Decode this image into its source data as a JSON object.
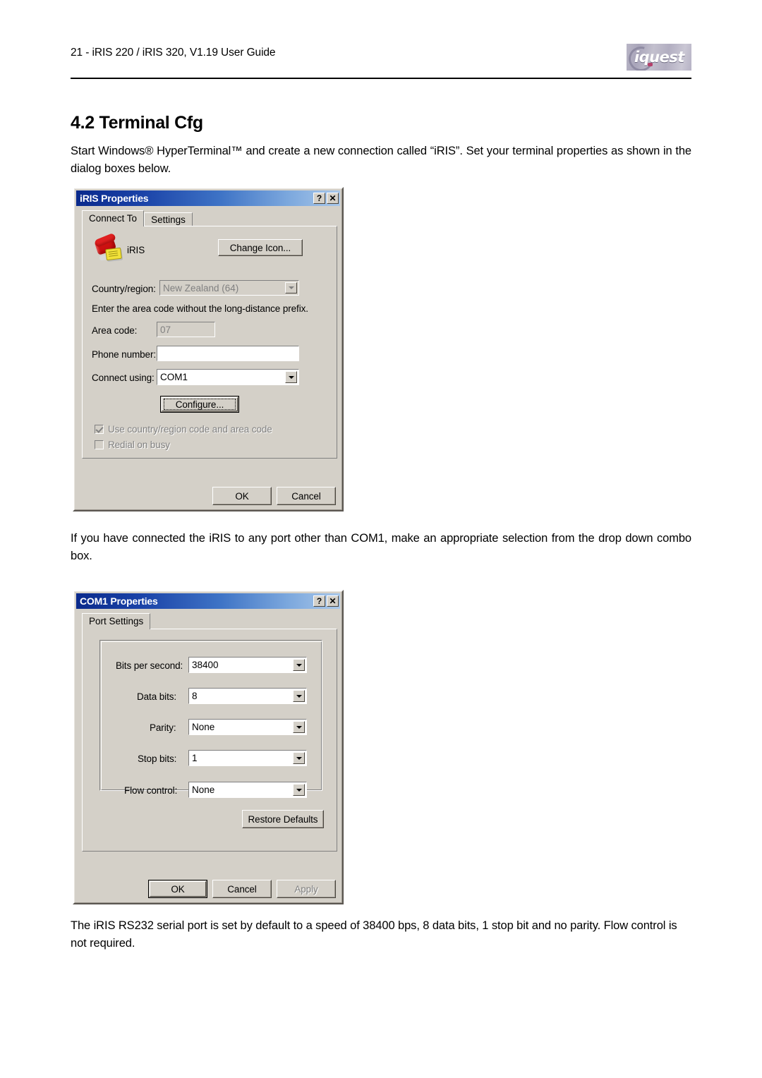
{
  "header": {
    "running_head": "21 - iRIS 220 / iRIS 320, V1.19 User Guide",
    "logo_text": "iquest"
  },
  "section": {
    "title": "4.2 Terminal Cfg",
    "intro_paragraph": "Start Windows® HyperTerminal™ and create a new connection called “iRIS”.  Set your terminal properties as shown in the dialog boxes below.",
    "middle_paragraph": "If you have connected the iRIS to any port other than COM1, make an appropriate selection from the drop down combo box.",
    "closing_paragraph": "The iRIS RS232 serial port is set by default to a speed of 38400 bps, 8 data bits, 1 stop bit and no parity. Flow control is not required."
  },
  "iris_dialog": {
    "title": "iRIS Properties",
    "help_button": "?",
    "close_button": "✕",
    "tabs": [
      {
        "label": "Connect To",
        "active": true
      },
      {
        "label": "Settings",
        "active": false
      }
    ],
    "connection_name": "iRIS",
    "change_icon_button": "Change Icon...",
    "country_label": "Country/region:",
    "country_value": "New Zealand (64)",
    "hint_text": "Enter the area code without the long-distance prefix.",
    "area_code_label": "Area code:",
    "area_code_value": "07",
    "phone_number_label": "Phone number:",
    "phone_number_value": "",
    "connect_using_label": "Connect using:",
    "connect_using_value": "COM1",
    "configure_button": "Configure...",
    "checkbox_country_code": "Use country/region code and area code",
    "checkbox_redial": "Redial on busy",
    "ok_button": "OK",
    "cancel_button": "Cancel"
  },
  "com1_dialog": {
    "title": "COM1 Properties",
    "help_button": "?",
    "close_button": "✕",
    "tabs": [
      {
        "label": "Port Settings",
        "active": true
      }
    ],
    "settings": [
      {
        "label": "Bits per second:",
        "value": "38400"
      },
      {
        "label": "Data bits:",
        "value": "8"
      },
      {
        "label": "Parity:",
        "value": "None"
      },
      {
        "label": "Stop bits:",
        "value": "1"
      },
      {
        "label": "Flow control:",
        "value": "None"
      }
    ],
    "restore_defaults_button": "Restore Defaults",
    "ok_button": "OK",
    "cancel_button": "Cancel",
    "apply_button": "Apply"
  },
  "colors": {
    "dialog_face": "#d4d0c8",
    "titlebar_start": "#0a2a8c",
    "titlebar_end": "#a9c8ea",
    "disabled_text": "#808080"
  }
}
